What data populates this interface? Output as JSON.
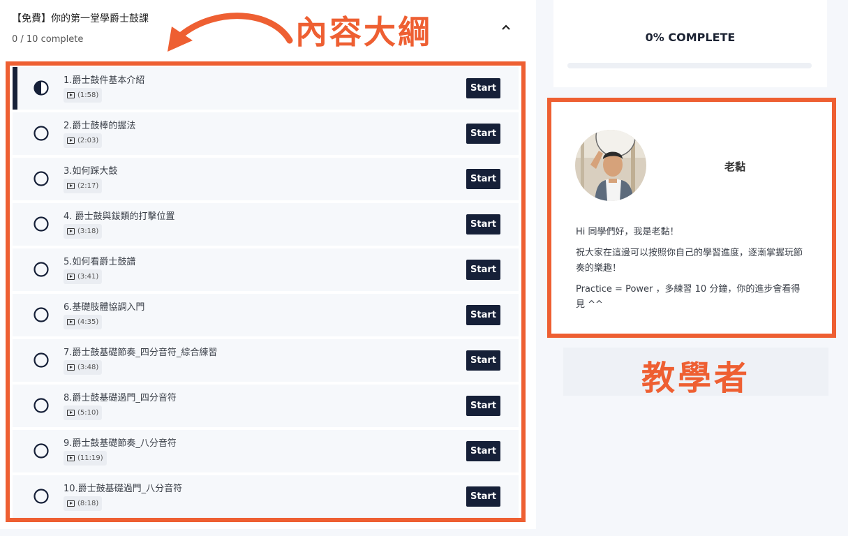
{
  "course": {
    "title": "【免費】你的第一堂學爵士鼓課",
    "progress_text": "0 / 10 complete"
  },
  "lessons": [
    {
      "title": "1.爵士鼓件基本介紹",
      "duration": "(1:58)",
      "button": "Start",
      "status": "in-progress"
    },
    {
      "title": "2.爵士鼓棒的握法",
      "duration": "(2:03)",
      "button": "Start",
      "status": "not-started"
    },
    {
      "title": "3.如何踩大鼓",
      "duration": "(2:17)",
      "button": "Start",
      "status": "not-started"
    },
    {
      "title": "4. 爵士鼓與鈸類的打擊位置",
      "duration": "(3:18)",
      "button": "Start",
      "status": "not-started"
    },
    {
      "title": "5.如何看爵士鼓譜",
      "duration": "(3:41)",
      "button": "Start",
      "status": "not-started"
    },
    {
      "title": "6.基礎肢體協調入門",
      "duration": "(4:35)",
      "button": "Start",
      "status": "not-started"
    },
    {
      "title": "7.爵士鼓基礎節奏_四分音符_綜合練習",
      "duration": "(3:48)",
      "button": "Start",
      "status": "not-started"
    },
    {
      "title": "8.爵士鼓基礎過門_四分音符",
      "duration": "(5:10)",
      "button": "Start",
      "status": "not-started"
    },
    {
      "title": "9.爵士鼓基礎節奏_八分音符",
      "duration": "(11:19)",
      "button": "Start",
      "status": "not-started"
    },
    {
      "title": "10.爵士鼓基礎過門_八分音符",
      "duration": "(8:18)",
      "button": "Start",
      "status": "not-started"
    }
  ],
  "progress": {
    "label": "0% COMPLETE",
    "value": 0
  },
  "instructor": {
    "name": "老黏",
    "bio": [
      "Hi 同學們好，我是老黏！",
      "祝大家在這邊可以按照你自己的學習進度，逐漸掌握玩節奏的樂趣！",
      "Practice = Power ，多練習 10 分鐘，你的進步會看得見 ^^"
    ]
  },
  "annotations": {
    "outline_label": "內容大綱",
    "instructor_label": "教學者"
  },
  "colors": {
    "accent": "#ee5f32",
    "dark": "#162038"
  },
  "icons": {
    "in_progress": "half-circle-icon",
    "not_started": "empty-circle-icon",
    "video": "video-icon",
    "collapse": "chevron-up-icon"
  }
}
